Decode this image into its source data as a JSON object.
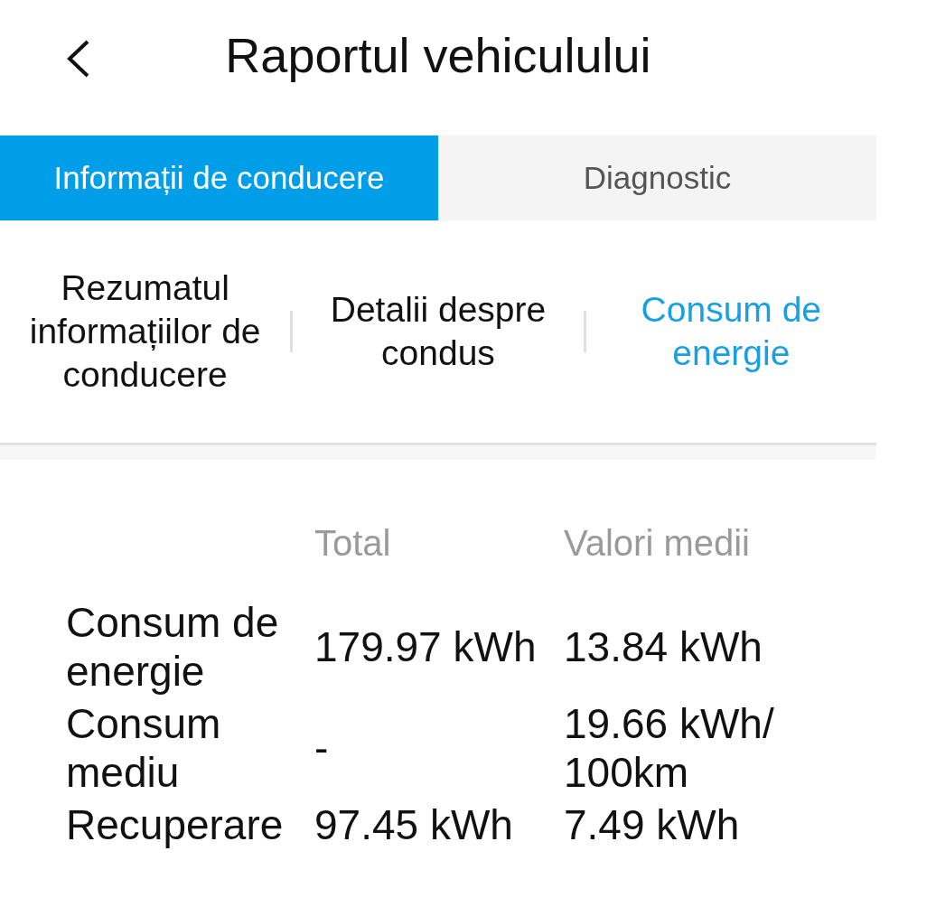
{
  "header": {
    "title": "Raportul vehiculului"
  },
  "tabs": [
    {
      "label": "Informații de conducere",
      "selected": true
    },
    {
      "label": "Diagnostic",
      "selected": false
    }
  ],
  "subtabs": [
    {
      "label": "Rezumatul informațiilor de conducere",
      "selected": false
    },
    {
      "label": "Detalii despre condus",
      "selected": false
    },
    {
      "label": "Consum de energie",
      "selected": true
    }
  ],
  "table": {
    "columns": [
      "Total",
      "Valori medii"
    ],
    "rows": [
      {
        "label": "Consum de energie",
        "total": "179.97 kWh",
        "average": "13.84 kWh"
      },
      {
        "label": "Consum mediu",
        "total": "-",
        "average": "19.66 kWh/ 100km"
      },
      {
        "label": "Recuperare",
        "total": "97.45 kWh",
        "average": "7.49 kWh"
      }
    ]
  }
}
